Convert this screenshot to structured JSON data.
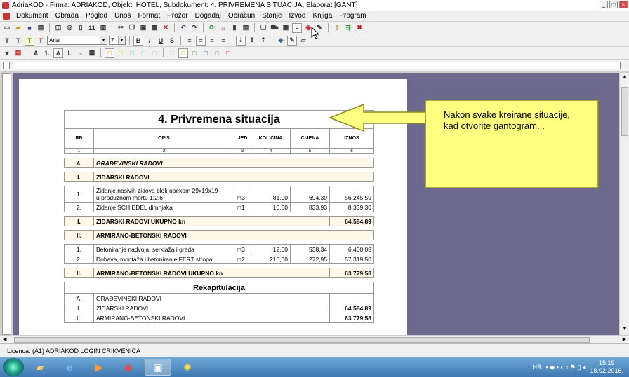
{
  "window": {
    "title": "AdriaKOD - Firma: ADRIAKOD,  Objekt: HOTEL,  Subdokument: 4. PRIVREMENA SITUACIJA,  Elaborat [GANT]"
  },
  "menu": [
    "Dokument",
    "Obrada",
    "Pogled",
    "Unos",
    "Format",
    "Prozor",
    "Događaj",
    "Obračun",
    "Stanje",
    "Izvod",
    "Knjiga",
    "Program"
  ],
  "format": {
    "font": "Arial",
    "size": "7"
  },
  "document": {
    "title": "4. Privremena situacija",
    "headers": [
      "RB",
      "OPIS",
      "JED",
      "KOLIČINA",
      "CIJENA",
      "IZNOS"
    ],
    "col_index": [
      "1",
      "2",
      "3",
      "4",
      "5",
      "6"
    ],
    "group_a": {
      "rb": "A.",
      "name": "GRAĐEVINSKI RADOVI"
    },
    "sec1": {
      "rb": "I.",
      "name": "ZIDARSKI RADOVI",
      "rows": [
        {
          "rb": "1.",
          "opis1": "Zidanje nosivih zidova blok opekom 29x19x19",
          "opis2": "u produžnom mortu 1:2:6",
          "jed": "m3",
          "kol": "81,00",
          "cij": "694,39",
          "izn": "56.245,59"
        },
        {
          "rb": "2.",
          "opis1": "Zidanje SCHIEDEL dimnjaka",
          "jed": "m1",
          "kol": "10,00",
          "cij": "833,93",
          "izn": "8.339,30"
        }
      ],
      "total_rb": "I.",
      "total_label": "ZIDARSKI RADOVI UKUPNO kn",
      "total": "64.584,89"
    },
    "sec2": {
      "rb": "II.",
      "name": "ARMIRANO-BETONSKI RADOVI",
      "rows": [
        {
          "rb": "1.",
          "opis1": "Betoniranje nadvoja, serklaža i greda",
          "jed": "m3",
          "kol": "12,00",
          "cij": "538,34",
          "izn": "6.460,08"
        },
        {
          "rb": "2.",
          "opis1": "Dobava, montaža i betoniranje FERT stropa",
          "jed": "m2",
          "kol": "210,00",
          "cij": "272,95",
          "izn": "57.319,50"
        }
      ],
      "total_rb": "II.",
      "total_label": "ARMIRANO-BETONSKI RADOVI UKUPNO kn",
      "total": "63.779,58"
    },
    "recap": {
      "title": "Rekapitulacija",
      "rows": [
        {
          "rb": "A.",
          "name": "GRAĐEVINSKI RADOVI",
          "val": ""
        },
        {
          "rb": "I.",
          "name": "ZIDARSKI RADOVI",
          "val": "64.584,89"
        },
        {
          "rb": "II.",
          "name": "ARMIRANO-BETONSKI RADOVI",
          "val": "63.779,58"
        }
      ]
    }
  },
  "callout": {
    "line1": "Nakon svake kreirane situacije,",
    "line2": "kad otvorite gantogram..."
  },
  "status": "Licenca: (A1) ADRIAKOD LOGIN CRIKVENICA",
  "tray": {
    "lang": "HR",
    "time": "15:19",
    "date": "18.02.2016."
  },
  "colors": {
    "workspace": "#6e6a8e",
    "callout": "#ffff80",
    "taskbar": "#3f78b3"
  }
}
